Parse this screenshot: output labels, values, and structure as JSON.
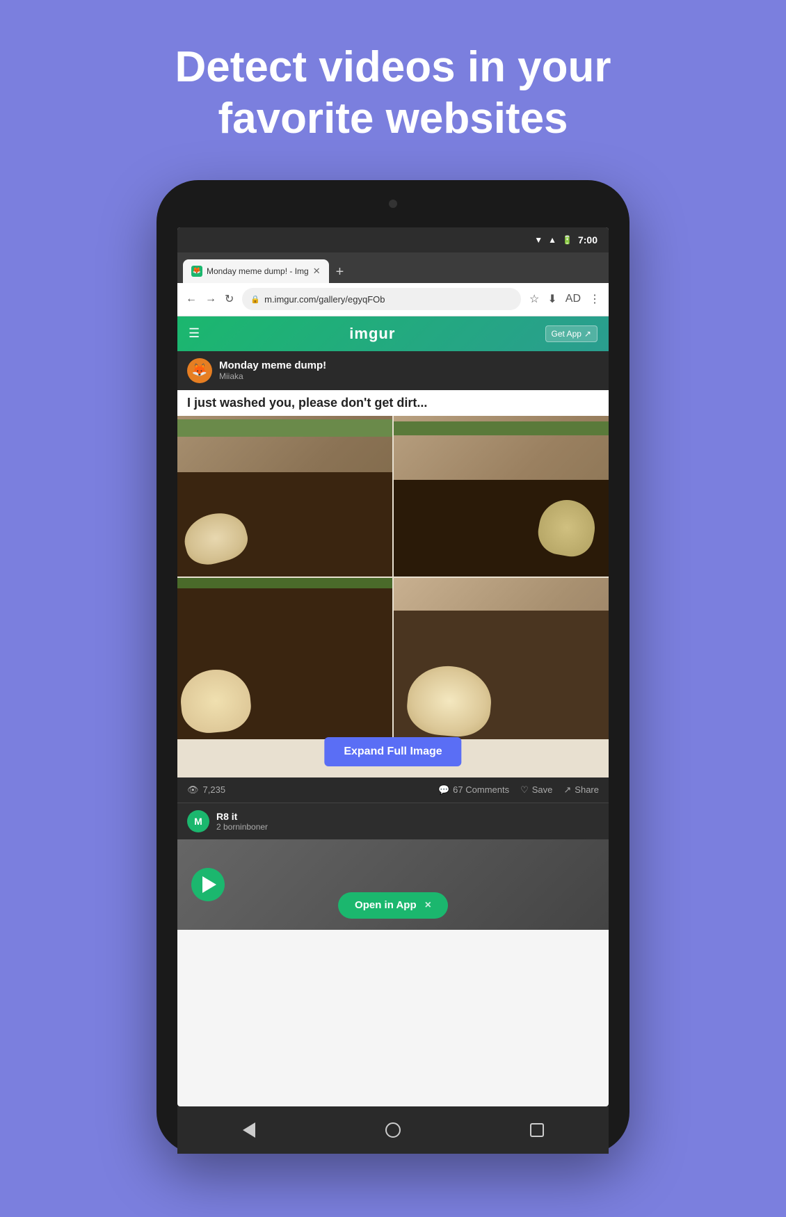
{
  "hero": {
    "title_line1": "Detect videos in your",
    "title_line2": "favorite websites"
  },
  "status_bar": {
    "time": "7:00"
  },
  "browser": {
    "tab_title": "Monday meme dump! - Img",
    "url": "m.imgur.com/gallery/egyqFOb",
    "new_tab_icon": "+"
  },
  "imgur": {
    "logo": "imgur",
    "get_app": "Get App",
    "menu_icon": "☰"
  },
  "post": {
    "title": "Monday meme dump!",
    "user": "Miiaka",
    "caption": "I just washed you, please don't get dirt...",
    "views_count": "7,235",
    "comments_count": "67 Comments",
    "save_label": "Save",
    "share_label": "Share",
    "expand_label": "Expand Full Image"
  },
  "next_post": {
    "title": "R8 it",
    "user": "2 borninboner",
    "open_in_app": "Open in App",
    "close_icon": "×"
  },
  "nav": {
    "back": "◁",
    "home": "○",
    "square": "□"
  }
}
